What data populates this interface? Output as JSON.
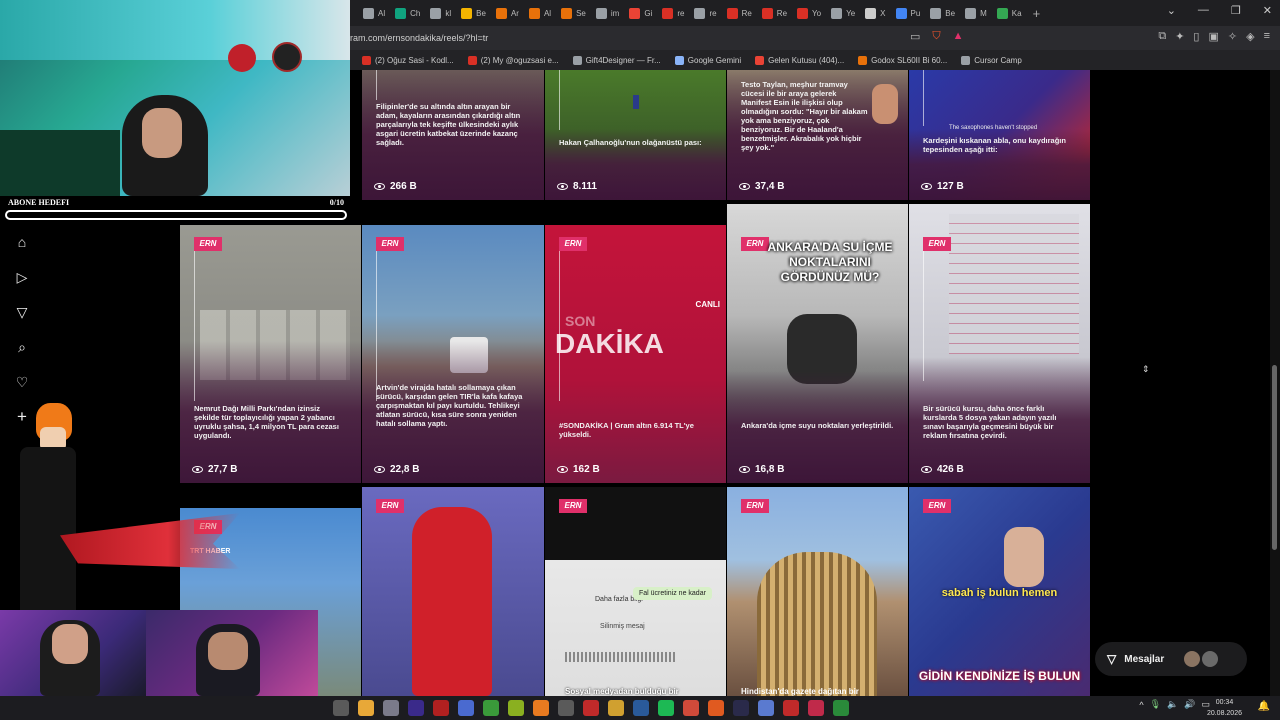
{
  "browser": {
    "tabs": [
      {
        "label": "Al",
        "color": "#9aa0a6"
      },
      {
        "label": "Ch",
        "color": "#10a37f"
      },
      {
        "label": "kl",
        "color": "#9aa0a6"
      },
      {
        "label": "Be",
        "color": "#f4b400"
      },
      {
        "label": "Ar",
        "color": "#e8710a"
      },
      {
        "label": "Al",
        "color": "#e8710a"
      },
      {
        "label": "Se",
        "color": "#e8710a"
      },
      {
        "label": "im",
        "color": "#9aa0a6"
      },
      {
        "label": "Gi",
        "color": "#ea4335"
      },
      {
        "label": "re",
        "color": "#d93025"
      },
      {
        "label": "re",
        "color": "#9aa0a6"
      },
      {
        "label": "Re",
        "color": "#d93025"
      },
      {
        "label": "Re",
        "color": "#d93025"
      },
      {
        "label": "Yo",
        "color": "#d93025"
      },
      {
        "label": "Ye",
        "color": "#9aa0a6"
      },
      {
        "label": "X",
        "color": "#cccccc"
      },
      {
        "label": "Pu",
        "color": "#4285f4"
      },
      {
        "label": "Be",
        "color": "#9aa0a6"
      },
      {
        "label": "M",
        "color": "#9aa0a6"
      },
      {
        "label": "Ka",
        "color": "#34a853"
      }
    ],
    "new_tab": "+",
    "url": "ram.com/ernsondakika/reels/?hl=tr",
    "bookmarks": [
      {
        "label": "(2) Oğuz Sasi - Kodl...",
        "color": "#d93025"
      },
      {
        "label": "(2) My @oguzsasi e...",
        "color": "#d93025"
      },
      {
        "label": "Gift4Designer — Fr...",
        "color": "#9aa0a6"
      },
      {
        "label": "Google Gemini",
        "color": "#8ab4f8"
      },
      {
        "label": "Gelen Kutusu (404)...",
        "color": "#ea4335"
      },
      {
        "label": "Godox SL60II Bi 60...",
        "color": "#e8710a"
      },
      {
        "label": "Cursor Camp",
        "color": "#9aa0a6"
      }
    ]
  },
  "stream": {
    "goal_label": "ABONE HEDEFI",
    "goal_count": "0/10"
  },
  "nav": {
    "icons": [
      "home-icon",
      "reels-icon",
      "explore-icon",
      "search-icon",
      "notifications-icon",
      "create-icon"
    ]
  },
  "reels_top": [
    {
      "caption": "Filipinler'de su altında altın arayan bir adam, kayaların arasından çıkardığı altın parçalarıyla tek keşifte ülkesindeki aylık asgari ücretin katbekat üzerinde kazanç sağladı.",
      "views": "266 B"
    },
    {
      "caption": "Hakan Çalhanoğlu'nun olağanüstü pası:",
      "views": "8.111"
    },
    {
      "caption": "Testo Taylan, meşhur tramvay cücesi ile bir araya gelerek Manifest Esin ile ilişkisi olup olmadığını sordu: \"Hayır bir alakam yok ama benziyoruz, çok benziyoruz. Bir de Haaland'a benzetmişler. Akrabalık yok hiçbir şey yok.\"",
      "views": "37,4 B"
    },
    {
      "caption": "Kardeşini kıskanan abla, onu kaydırağın tepesinden aşağı itti:",
      "overlay": "The saxophones haven't stopped",
      "views": "127 B"
    }
  ],
  "reels_mid": [
    {
      "caption": "Nemrut Dağı Milli Parkı'ndan izinsiz şekilde tür toplayıcılığı yapan 2 yabancı uyruklu şahsa, 1,4 milyon TL para cezası uygulandı.",
      "views": "27,7 B"
    },
    {
      "caption": "Artvin'de virajda hatalı sollamaya çıkan sürücü, karşıdan gelen TIR'la kafa kafaya çarpışmaktan kıl payı kurtuldu. Tehlikeyi atlatan sürücü, kısa süre sonra yeniden hatalı sollama yaptı.",
      "views": "22,8 B"
    },
    {
      "caption": "#SONDAKİKA | Gram altın 6.914 TL'ye yükseldi.",
      "son": "SON",
      "dakika": "DAKİKA",
      "canli": "CANLI",
      "views": "162 B"
    },
    {
      "caption": "Ankara'da içme suyu noktaları yerleştirildi.",
      "headline": "ANKARA'DA SU İÇME NOKTALARINI GÖRDÜNÜZ MÜ?",
      "views": "16,8 B"
    },
    {
      "caption": "Bir sürücü kursu, daha önce farklı kurslarda 5 dosya yakan adayın yazılı sınavı başarıyla geçmesini büyük bir reklam fırsatına çevirdi.",
      "views": "426 B"
    }
  ],
  "reels_bottom": [
    {
      "overlay": "TRT HABER"
    },
    {
      "overlay": ""
    },
    {
      "overlay": "Daha fazla bilgi",
      "bubble": "Fal ücretiniz ne kadar",
      "deleted": "Silinmiş mesaj",
      "bottom": "Sosyal medyadan bulduğu bir"
    },
    {
      "bottom": "Hindistan'da gazete dağıtan bir"
    },
    {
      "subtitle": "sabah iş bulun hemen",
      "bottom": "GİDİN KENDİNİZE İŞ BULUN"
    }
  ],
  "messages": {
    "label": "Mesajlar"
  },
  "taskbar": {
    "time": "00:34",
    "date": "20.08.2026"
  },
  "colors": {
    "accent": "#e0306a",
    "dakika_red": "#c4143a"
  }
}
